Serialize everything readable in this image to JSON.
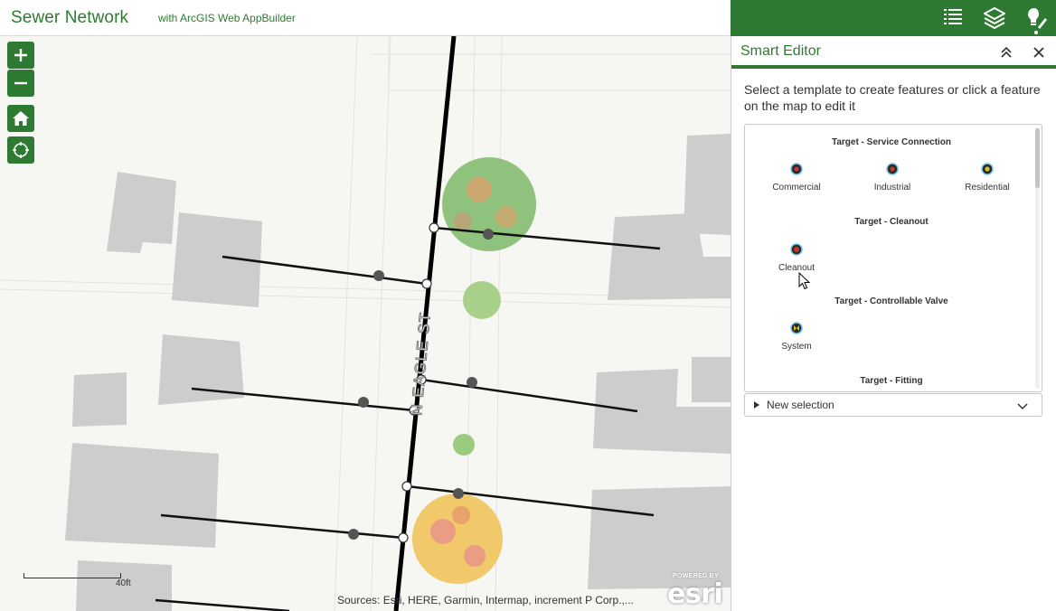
{
  "header": {
    "title": "Sewer Network",
    "subtitle": "with ArcGIS Web AppBuilder",
    "accent_color": "#2f7a32",
    "tools": [
      {
        "name": "attribute-table-icon"
      },
      {
        "name": "layer-list-icon"
      },
      {
        "name": "smart-editor-icon",
        "active": true
      }
    ]
  },
  "map": {
    "street_label": "N EAGLE ST",
    "scale_label": "40ft",
    "attribution": "Sources: Esri, HERE, Garmin, Intermap, increment P Corp.,...",
    "logo": {
      "powered_by": "POWERED BY",
      "word": "esri"
    },
    "controls": [
      "zoom-in",
      "zoom-out",
      "home",
      "locate"
    ]
  },
  "panel": {
    "title": "Smart Editor",
    "description": "Select a template to create features or click a feature on the map to edit it",
    "template_groups": [
      {
        "title": "Target - Service Connection",
        "items": [
          {
            "label": "Commercial",
            "color": "#c0392b"
          },
          {
            "label": "Industrial",
            "color": "#c0392b"
          },
          {
            "label": "Residential",
            "color": "#d4c21f"
          }
        ]
      },
      {
        "title": "Target - Cleanout",
        "items": [
          {
            "label": "Cleanout",
            "color": "#c0392b"
          }
        ]
      },
      {
        "title": "Target - Controllable Valve",
        "items": [
          {
            "label": "System",
            "color": "#d4c21f"
          }
        ]
      },
      {
        "title": "Target - Fitting",
        "items": []
      }
    ],
    "new_selection_label": "New selection"
  }
}
